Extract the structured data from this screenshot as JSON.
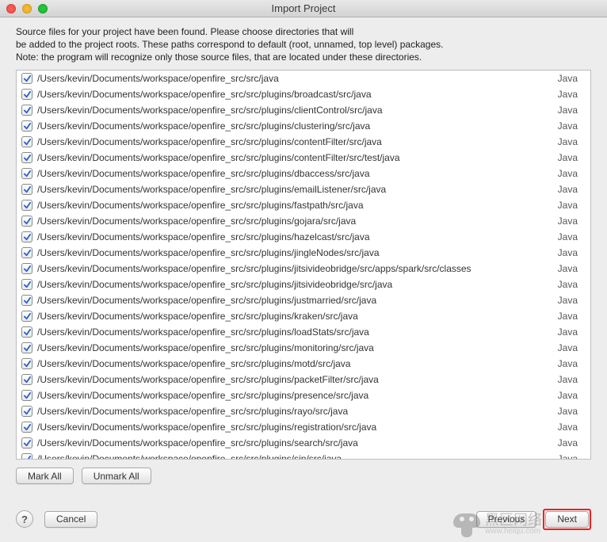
{
  "window": {
    "title": "Import Project"
  },
  "description": {
    "line1": "Source files for your project have been found. Please choose directories that will",
    "line2": "be added to the project roots. These paths correspond to default (root, unnamed, top level) packages.",
    "line3": "Note: the program will recognize only those source files, that are located under these directories."
  },
  "columns": {
    "type_label": "Java"
  },
  "rows": [
    {
      "checked": true,
      "path": "/Users/kevin/Documents/workspace/openfire_src/src/java",
      "type": "Java"
    },
    {
      "checked": true,
      "path": "/Users/kevin/Documents/workspace/openfire_src/src/plugins/broadcast/src/java",
      "type": "Java"
    },
    {
      "checked": true,
      "path": "/Users/kevin/Documents/workspace/openfire_src/src/plugins/clientControl/src/java",
      "type": "Java"
    },
    {
      "checked": true,
      "path": "/Users/kevin/Documents/workspace/openfire_src/src/plugins/clustering/src/java",
      "type": "Java"
    },
    {
      "checked": true,
      "path": "/Users/kevin/Documents/workspace/openfire_src/src/plugins/contentFilter/src/java",
      "type": "Java"
    },
    {
      "checked": true,
      "path": "/Users/kevin/Documents/workspace/openfire_src/src/plugins/contentFilter/src/test/java",
      "type": "Java"
    },
    {
      "checked": true,
      "path": "/Users/kevin/Documents/workspace/openfire_src/src/plugins/dbaccess/src/java",
      "type": "Java"
    },
    {
      "checked": true,
      "path": "/Users/kevin/Documents/workspace/openfire_src/src/plugins/emailListener/src/java",
      "type": "Java"
    },
    {
      "checked": true,
      "path": "/Users/kevin/Documents/workspace/openfire_src/src/plugins/fastpath/src/java",
      "type": "Java"
    },
    {
      "checked": true,
      "path": "/Users/kevin/Documents/workspace/openfire_src/src/plugins/gojara/src/java",
      "type": "Java"
    },
    {
      "checked": true,
      "path": "/Users/kevin/Documents/workspace/openfire_src/src/plugins/hazelcast/src/java",
      "type": "Java"
    },
    {
      "checked": true,
      "path": "/Users/kevin/Documents/workspace/openfire_src/src/plugins/jingleNodes/src/java",
      "type": "Java"
    },
    {
      "checked": true,
      "path": "/Users/kevin/Documents/workspace/openfire_src/src/plugins/jitsivideobridge/src/apps/spark/src/classes",
      "type": "Java"
    },
    {
      "checked": true,
      "path": "/Users/kevin/Documents/workspace/openfire_src/src/plugins/jitsivideobridge/src/java",
      "type": "Java"
    },
    {
      "checked": true,
      "path": "/Users/kevin/Documents/workspace/openfire_src/src/plugins/justmarried/src/java",
      "type": "Java"
    },
    {
      "checked": true,
      "path": "/Users/kevin/Documents/workspace/openfire_src/src/plugins/kraken/src/java",
      "type": "Java"
    },
    {
      "checked": true,
      "path": "/Users/kevin/Documents/workspace/openfire_src/src/plugins/loadStats/src/java",
      "type": "Java"
    },
    {
      "checked": true,
      "path": "/Users/kevin/Documents/workspace/openfire_src/src/plugins/monitoring/src/java",
      "type": "Java"
    },
    {
      "checked": true,
      "path": "/Users/kevin/Documents/workspace/openfire_src/src/plugins/motd/src/java",
      "type": "Java"
    },
    {
      "checked": true,
      "path": "/Users/kevin/Documents/workspace/openfire_src/src/plugins/packetFilter/src/java",
      "type": "Java"
    },
    {
      "checked": true,
      "path": "/Users/kevin/Documents/workspace/openfire_src/src/plugins/presence/src/java",
      "type": "Java"
    },
    {
      "checked": true,
      "path": "/Users/kevin/Documents/workspace/openfire_src/src/plugins/rayo/src/java",
      "type": "Java"
    },
    {
      "checked": true,
      "path": "/Users/kevin/Documents/workspace/openfire_src/src/plugins/registration/src/java",
      "type": "Java"
    },
    {
      "checked": true,
      "path": "/Users/kevin/Documents/workspace/openfire_src/src/plugins/search/src/java",
      "type": "Java"
    },
    {
      "checked": true,
      "path": "/Users/kevin/Documents/workspace/openfire_src/src/plugins/sip/src/java",
      "type": "Java"
    }
  ],
  "buttons": {
    "mark_all": "Mark All",
    "unmark_all": "Unmark All",
    "help": "?",
    "cancel": "Cancel",
    "previous": "Previous",
    "next": "Next"
  },
  "watermark": {
    "main": "黑区网络",
    "sub": "www.heiqu.com"
  }
}
